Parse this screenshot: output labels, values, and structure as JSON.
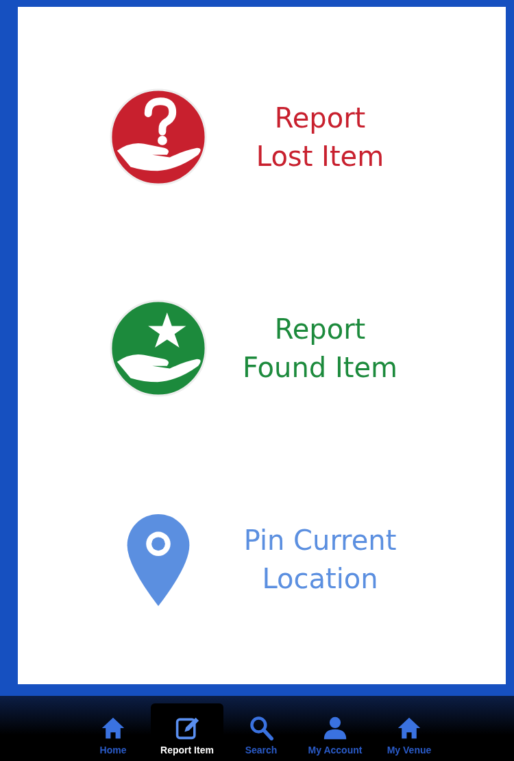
{
  "actions": [
    {
      "kind": "lost",
      "lines": [
        "Report",
        "Lost Item"
      ],
      "color": "#c8202e"
    },
    {
      "kind": "found",
      "lines": [
        "Report",
        "Found Item"
      ],
      "color": "#1c8a3c"
    },
    {
      "kind": "pin",
      "lines": [
        "Pin Current",
        "Location"
      ],
      "color": "#5b8fe0"
    }
  ],
  "tab_bar": [
    {
      "kind": "home",
      "label": "Home",
      "selected": false
    },
    {
      "kind": "edit",
      "label": "Report Item",
      "selected": true
    },
    {
      "kind": "search",
      "label": "Search",
      "selected": false
    },
    {
      "kind": "person",
      "label": "My Account",
      "selected": false
    },
    {
      "kind": "home",
      "label": "My Venue",
      "selected": false
    }
  ]
}
